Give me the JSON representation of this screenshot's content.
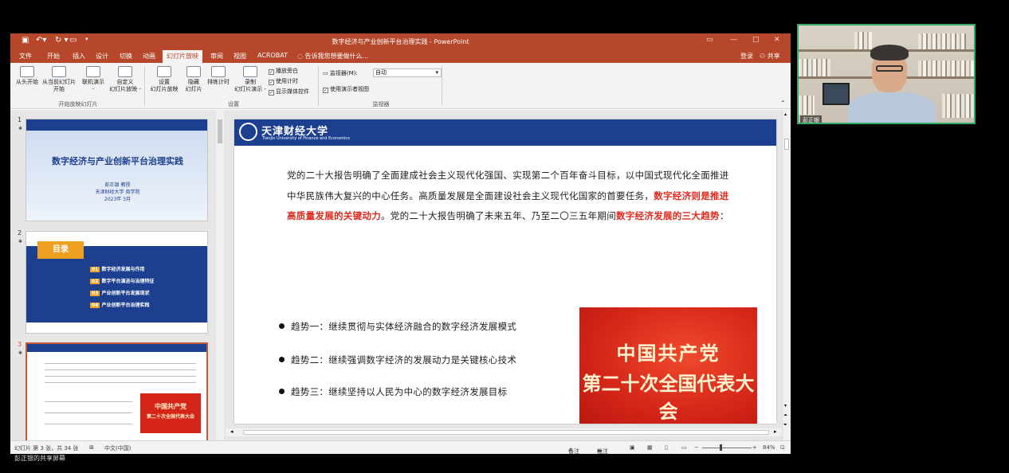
{
  "window": {
    "title": "数字经济与产业创新平台治理实践 - PowerPoint",
    "qat_redo": "↻ ▾"
  },
  "menu": {
    "tabs": [
      "文件",
      "开始",
      "插入",
      "设计",
      "切换",
      "动画",
      "幻灯片放映",
      "审阅",
      "视图",
      "ACROBAT"
    ],
    "active_tab": "幻灯片放映",
    "tell_me": "告诉我您想要做什么...",
    "login": "登录",
    "share": "共享"
  },
  "ribbon": {
    "from_start": "从头开始",
    "from_current_l1": "从当前幻灯片",
    "from_current_l2": "开始",
    "online_l1": "联机演示",
    "online_l2": "-",
    "custom_l1": "自定义",
    "custom_l2": "幻灯片放映 -",
    "group_start": "开始放映幻灯片",
    "setup_l1": "设置",
    "setup_l2": "幻灯片放映",
    "hide_l1": "隐藏",
    "hide_l2": "幻灯片",
    "rehearse": "排练计时",
    "record_l1": "录制",
    "record_l2": "幻灯片演示 -",
    "narration": "播放旁白",
    "timings": "使用计时",
    "media_controls": "显示媒体控件",
    "group_setup": "设置",
    "monitor_label": "监视器(M):",
    "monitor_value": "自动",
    "presenter_view": "使用演示者视图",
    "group_monitors": "监视器"
  },
  "thumbnails": [
    {
      "num": "1",
      "title": "数字经济与产业创新平台治理实践",
      "author": "彭正银  教授",
      "school": "天津财经大学 商学院",
      "date": "2023年 3月"
    },
    {
      "num": "2",
      "title": "目录",
      "items": [
        {
          "no": "01",
          "text": "数字经济发展与作用"
        },
        {
          "no": "02",
          "text": "数字平台演进与治理特征"
        },
        {
          "no": "03",
          "text": "产业创新平台发展现状"
        },
        {
          "no": "04",
          "text": "产业创新平台治理实践"
        }
      ]
    },
    {
      "num": "3"
    }
  ],
  "slide": {
    "university_cn": "天津财经大学",
    "university_en": "Tianjin University of Finance and Economics",
    "p1": "党的二十大报告明确了全面建成社会主义现代化强国、实现第二个百年奋斗目标，以中国式现代化全面推进中华民族伟大复兴的中心任务。高质量发展是全面建设社会主义现代化国家的首要任务，",
    "p1_red": "数字经济则是推进高质量发展的关键动力",
    "p2": "。党的二十大报告明确了未来五年、乃至二〇三五年期间",
    "p2_red": "数字经济发展的三大趋势",
    "p3": "：",
    "trends": [
      "趋势一：继续贯彻与实体经济融合的数字经济发展模式",
      "趋势二：继续强调数字经济的发展动力是关键核心技术",
      "趋势三：继续坚持以人民为中心的数字经济发展目标"
    ],
    "image_line1": "中国共产党",
    "image_line2": "第二十次全国代表大会"
  },
  "status": {
    "slide_info": "幻灯片 第 3 张，共 34 张",
    "language": "中文(中国)",
    "notes": "备注",
    "comments": "批注",
    "zoom": "84%"
  },
  "share_label": "彭正银的共享屏幕",
  "camera": {
    "name": "彭正银"
  },
  "colors": {
    "ppt_accent": "#b7472a",
    "slide_header": "#1c3f8f",
    "highlight_red": "#e02a1f"
  }
}
